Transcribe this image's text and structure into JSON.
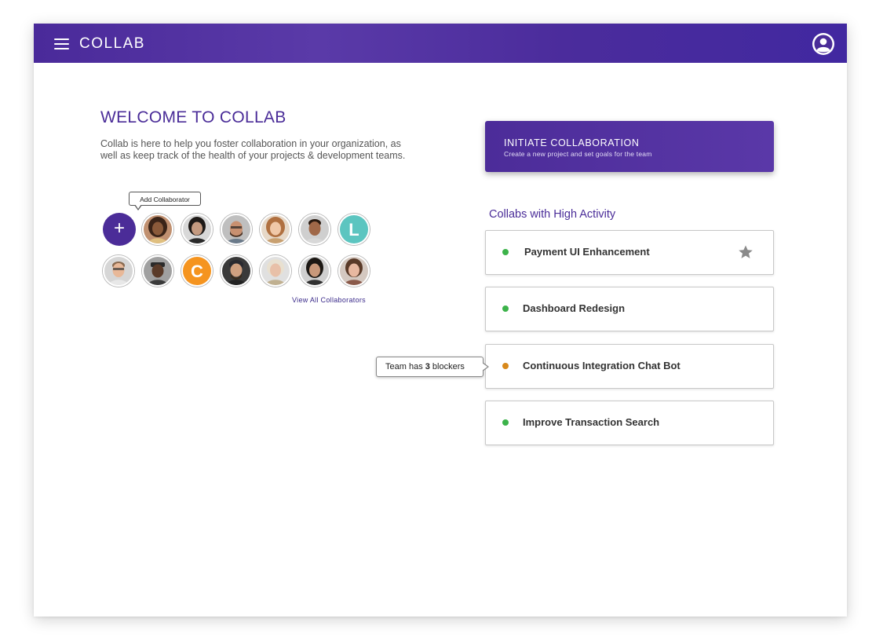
{
  "header": {
    "app_title": "COLLAB",
    "menu_icon": "hamburger-menu-icon",
    "profile_icon": "user-avatar-icon"
  },
  "welcome": {
    "title": "WELCOME TO COLLAB",
    "description": "Collab is here to help you foster collaboration in your organization, as well as keep track of the health of your projects & development teams."
  },
  "collaborators": {
    "add_tooltip": "Add Collaborator",
    "add_button_label": "+",
    "view_all_label": "View All Collaborators",
    "letter_avatars": [
      {
        "letter": "L",
        "color": "#5cc5c0"
      },
      {
        "letter": "C",
        "color": "#f5941f"
      }
    ]
  },
  "initiate": {
    "title": "INITIATE COLLABORATION",
    "subtitle": "Create a new project and set goals for the team"
  },
  "high_activity": {
    "title": "Collabs with High Activity",
    "items": [
      {
        "name": "Payment UI Enhancement",
        "status_color": "#3cb34a",
        "starred": true
      },
      {
        "name": "Dashboard Redesign",
        "status_color": "#3cb34a",
        "starred": false
      },
      {
        "name": "Continuous Integration Chat Bot",
        "status_color": "#d8891c",
        "starred": false
      },
      {
        "name": "Improve Transaction Search",
        "status_color": "#3cb34a",
        "starred": false
      }
    ]
  },
  "blocker_tooltip": {
    "prefix": "Team has ",
    "count": "3",
    "suffix": " blockers"
  },
  "colors": {
    "brand_purple": "#4b2c98",
    "status_green": "#3cb34a",
    "status_amber": "#d8891c"
  }
}
